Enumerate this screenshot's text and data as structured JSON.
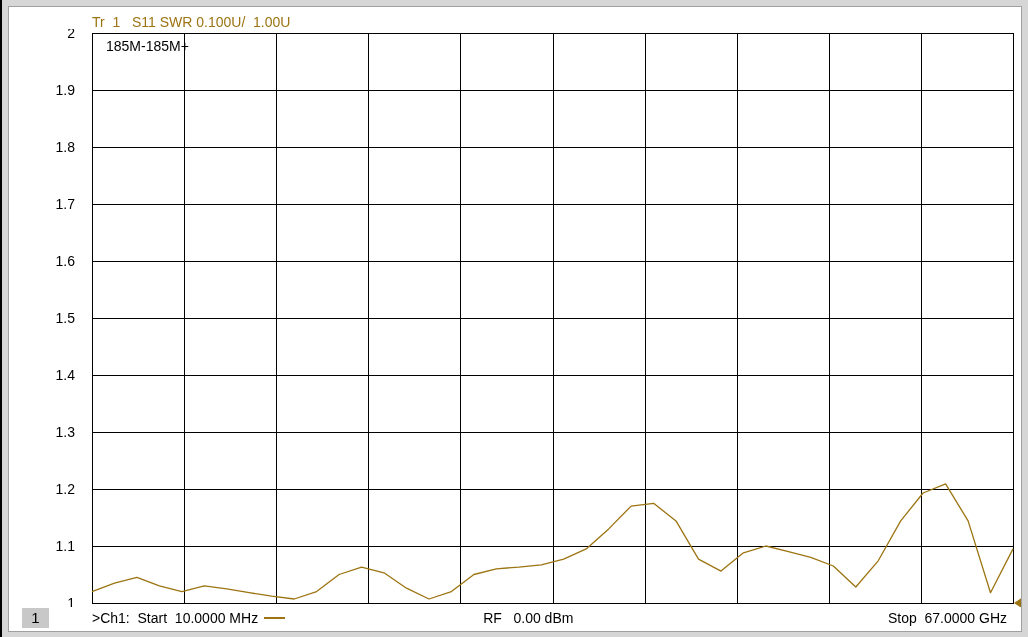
{
  "trace_header": "Tr  1   S11 SWR 0.100U/  1.00U",
  "chart_data": {
    "type": "line",
    "grid": true,
    "ylim": [
      1,
      2
    ],
    "yticks": [
      {
        "value": 1,
        "label": "1"
      },
      {
        "value": 1.1,
        "label": "1.1"
      },
      {
        "value": 1.2,
        "label": "1.2"
      },
      {
        "value": 1.3,
        "label": "1.3"
      },
      {
        "value": 1.4,
        "label": "1.4"
      },
      {
        "value": 1.5,
        "label": "1.5"
      },
      {
        "value": 1.6,
        "label": "1.6"
      },
      {
        "value": 1.7,
        "label": "1.7"
      },
      {
        "value": 1.8,
        "label": "1.8"
      },
      {
        "value": 1.9,
        "label": "1.9"
      },
      {
        "value": 2,
        "label": "2"
      }
    ],
    "series": [
      {
        "color": "#9c7412",
        "values": [
          1.02,
          1.035,
          1.045,
          1.03,
          1.02,
          1.03,
          1.025,
          1.018,
          1.012,
          1.007,
          1.02,
          1.05,
          1.063,
          1.053,
          1.026,
          1.007,
          1.02,
          1.05,
          1.06,
          1.063,
          1.067,
          1.077,
          1.095,
          1.13,
          1.17,
          1.175,
          1.144,
          1.077,
          1.056,
          1.088,
          1.1,
          1.09,
          1.08,
          1.065,
          1.028,
          1.074,
          1.144,
          1.193,
          1.209,
          1.144,
          1.018,
          1.095
        ]
      }
    ]
  },
  "marker_label": "185M-185M+",
  "channel_badge": "1",
  "status_bar": {
    "sweep": ">Ch1:  Start  10.0000 MHz",
    "power": "RF   0.00 dBm",
    "stop": "Stop  67.0000 GHz"
  }
}
